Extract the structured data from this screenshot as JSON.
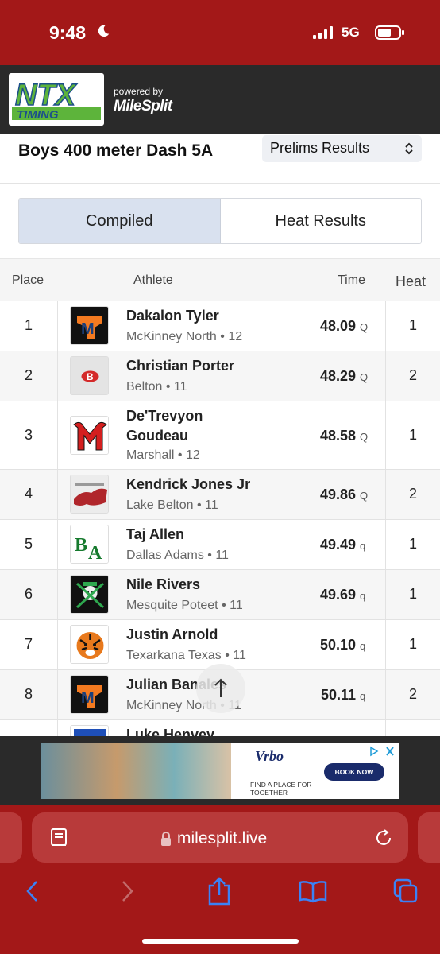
{
  "status_bar": {
    "time": "9:48",
    "network": "5G"
  },
  "header": {
    "logo_top": "NTX",
    "logo_bottom": "TIMING",
    "powered_by": "powered by",
    "brand": "MileSplit"
  },
  "event": {
    "title": "Boys 400 meter Dash 5A",
    "round": "Prelims Results"
  },
  "tabs": [
    {
      "label": "Compiled",
      "active": true
    },
    {
      "label": "Heat Results",
      "active": false
    }
  ],
  "table": {
    "headers": {
      "place": "Place",
      "athlete": "Athlete",
      "time": "Time",
      "heat": "Heat"
    },
    "rows": [
      {
        "place": "1",
        "name": "Dakalon Tyler",
        "school": "McKinney North • 12",
        "time": "48.09",
        "qual": "Q",
        "heat": "1"
      },
      {
        "place": "2",
        "name": "Christian Porter",
        "school": "Belton • 11",
        "time": "48.29",
        "qual": "Q",
        "heat": "2"
      },
      {
        "place": "3",
        "name": "De'Trevyon Goudeau",
        "school": "Marshall • 12",
        "time": "48.58",
        "qual": "Q",
        "heat": "1"
      },
      {
        "place": "4",
        "name": "Kendrick Jones Jr",
        "school": "Lake Belton • 11",
        "time": "49.86",
        "qual": "Q",
        "heat": "2"
      },
      {
        "place": "5",
        "name": "Taj Allen",
        "school": "Dallas Adams • 11",
        "time": "49.49",
        "qual": "q",
        "heat": "1"
      },
      {
        "place": "6",
        "name": "Nile Rivers",
        "school": "Mesquite Poteet • 11",
        "time": "49.69",
        "qual": "q",
        "heat": "1"
      },
      {
        "place": "7",
        "name": "Justin Arnold",
        "school": "Texarkana Texas • 11",
        "time": "50.10",
        "qual": "q",
        "heat": "1"
      },
      {
        "place": "8",
        "name": "Julian Banales",
        "school": "McKinney North • 11",
        "time": "50.11",
        "qual": "q",
        "heat": "2"
      },
      {
        "place": "",
        "name": "Luke Henvey",
        "school": "",
        "time": "",
        "qual": "",
        "heat": ""
      }
    ]
  },
  "ad": {
    "brand": "Vrbo",
    "tagline": "FIND A PLACE FOR TOGETHER",
    "cta": "BOOK NOW"
  },
  "browser": {
    "url": "milesplit.live"
  },
  "colors": {
    "chrome_red": "#a31818",
    "header_dark": "#2a2a2a",
    "tab_active": "#d9e1ef"
  }
}
